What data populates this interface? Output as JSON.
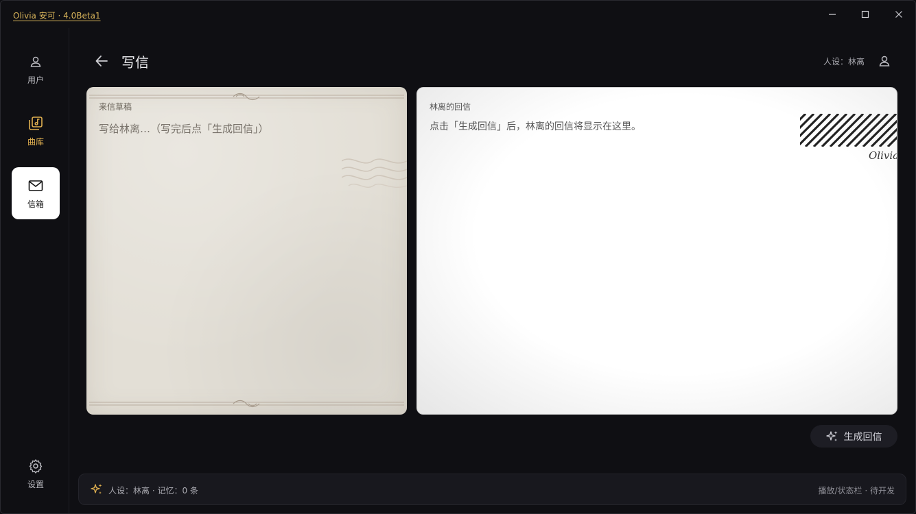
{
  "app": {
    "title": "Olivia 安可 · 4.0Beta1"
  },
  "sidebar": {
    "items": [
      {
        "label": "用户",
        "icon": "user-icon"
      },
      {
        "label": "曲库",
        "icon": "music-library-icon",
        "color": "#e0b050"
      },
      {
        "label": "信箱",
        "icon": "mail-icon",
        "active": true
      },
      {
        "label": "设置",
        "icon": "gear-icon"
      }
    ]
  },
  "header": {
    "title": "写信",
    "persona": "人设：林离"
  },
  "draft": {
    "label": "来信草稿",
    "placeholder": "写给林离…（写完后点「生成回信」）",
    "value": ""
  },
  "reply": {
    "label": "林离的回信",
    "placeholder": "点击「生成回信」后，林离的回信将显示在这里。",
    "stamp_signature": "Olivia"
  },
  "actions": {
    "generate_label": "生成回信"
  },
  "status": {
    "left": "人设：林离 · 记忆：0 条",
    "right": "播放/状态栏 · 待开发"
  },
  "colors": {
    "accent": "#e0b050",
    "background": "#0f0f13"
  }
}
